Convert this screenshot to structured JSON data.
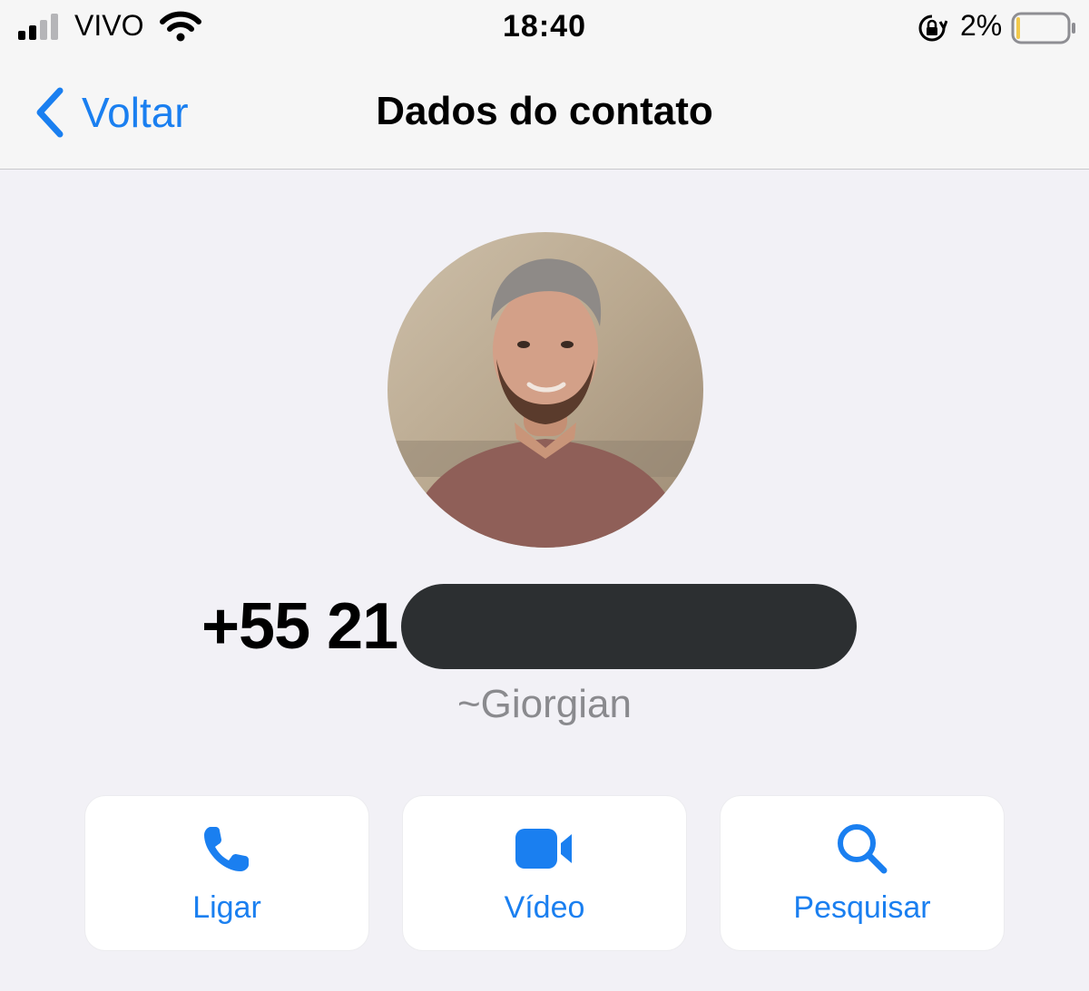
{
  "status_bar": {
    "carrier": "VIVO",
    "time": "18:40",
    "battery_percent": "2%",
    "battery_level": 0.02,
    "signal_bars": 2,
    "icons": [
      "signal-icon",
      "wifi-icon",
      "rotation-lock-icon",
      "battery-icon"
    ]
  },
  "nav": {
    "back_label": "Voltar",
    "title": "Dados do contato"
  },
  "contact": {
    "phone": "+55 21",
    "push_name": "~Giorgian"
  },
  "actions": {
    "call_label": "Ligar",
    "video_label": "Vídeo",
    "search_label": "Pesquisar"
  },
  "colors": {
    "accent": "#1a7ff0",
    "background": "#f2f1f6",
    "redaction": "#2c2f31"
  }
}
